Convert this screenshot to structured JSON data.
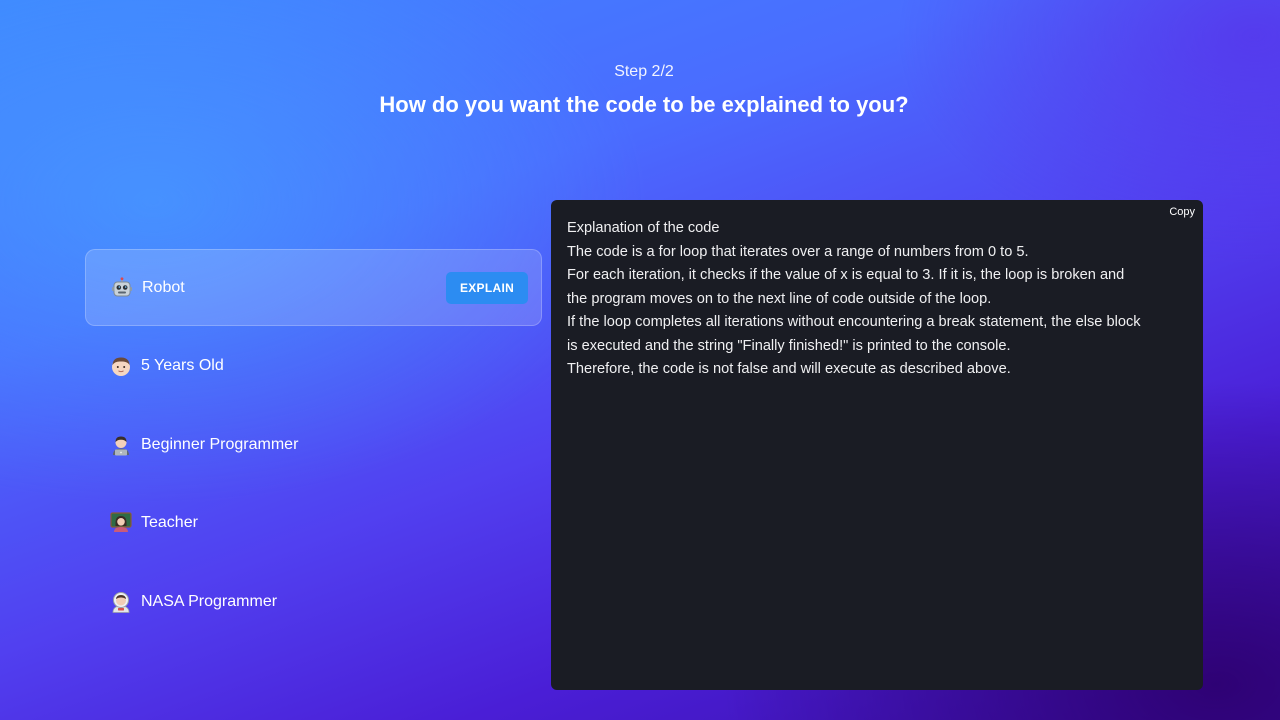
{
  "header": {
    "step": "Step 2/2",
    "question": "How do you want the code to be explained to you?"
  },
  "options": [
    {
      "label": "Robot",
      "icon": "robot-icon"
    },
    {
      "label": "5 Years Old",
      "icon": "child-icon"
    },
    {
      "label": "Beginner Programmer",
      "icon": "technologist-icon"
    },
    {
      "label": "Teacher",
      "icon": "teacher-icon"
    },
    {
      "label": "NASA Programmer",
      "icon": "astronaut-icon"
    }
  ],
  "explain_button": "EXPLAIN",
  "panel": {
    "copy_label": "Copy",
    "lines": [
      "Explanation of the code",
      "The code is a for loop that iterates over a range of numbers from 0 to 5.",
      "For each iteration, it checks if the value of x is equal to 3. If it is, the loop is broken and",
      "the program moves on to the next line of code outside of the loop.",
      "If the loop completes all iterations without encountering a break statement, the else block",
      "is executed and the string \"Finally finished!\" is printed to the console.",
      "Therefore, the code is not false and will execute as described above."
    ]
  },
  "colors": {
    "accent": "#2c8cf2",
    "panel_bg": "#1a1c24"
  }
}
